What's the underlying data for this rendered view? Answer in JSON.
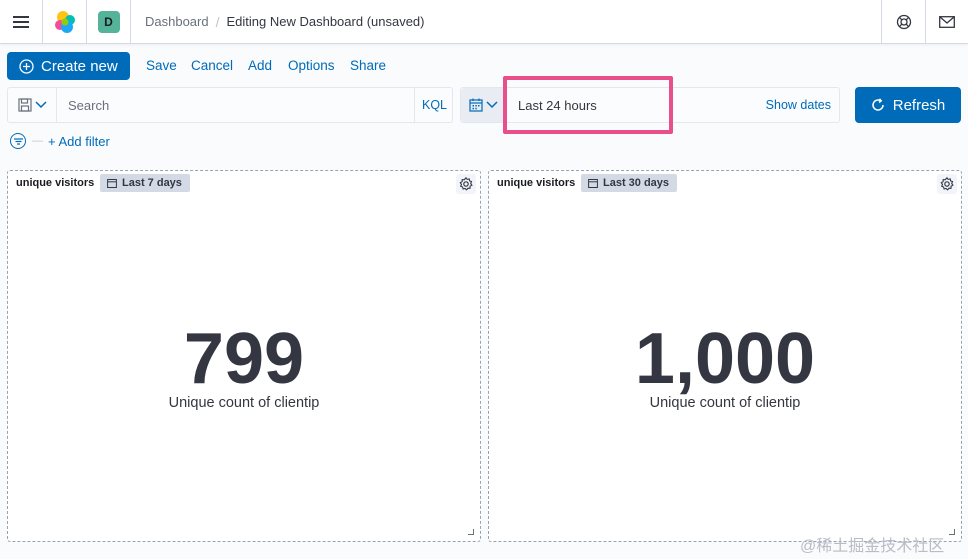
{
  "header": {
    "space_initial": "D",
    "breadcrumbs": [
      "Dashboard",
      "Editing New Dashboard (unsaved)"
    ],
    "breadcrumb_separator": "/"
  },
  "topnav": {
    "create_label": "Create new",
    "links": [
      "Save",
      "Cancel",
      "Add",
      "Options",
      "Share"
    ]
  },
  "query": {
    "placeholder": "Search",
    "language": "KQL"
  },
  "datepicker": {
    "value": "Last 24 hours",
    "show_dates": "Show dates"
  },
  "refresh_label": "Refresh",
  "filter": {
    "add_label": "+ Add filter"
  },
  "panels": [
    {
      "title": "unique visitors",
      "time_range": "Last 7 days",
      "value": "799",
      "label": "Unique count of clientip"
    },
    {
      "title": "unique visitors",
      "time_range": "Last 30 days",
      "value": "1,000",
      "label": "Unique count of clientip"
    }
  ],
  "watermark": "@稀土掘金技术社区",
  "colors": {
    "primary": "#006bb8",
    "highlight": "#e8508b",
    "space_badge": "#54b399"
  }
}
